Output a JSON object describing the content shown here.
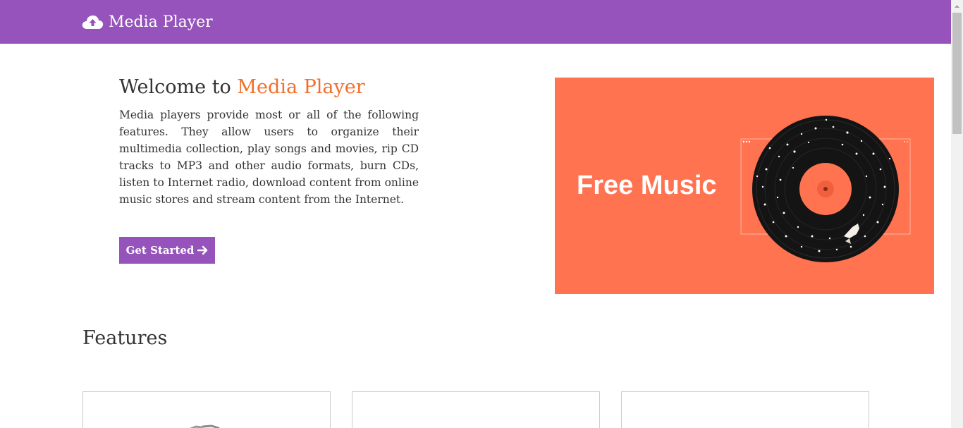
{
  "navbar": {
    "brand_name": "Media Player",
    "brand_icon": "cloud-upload-icon",
    "background": "#9553bb"
  },
  "hero": {
    "title_prefix": "Welcome to",
    "title_accent": "Media Player",
    "accent_color": "#f26f2b",
    "description": "Media players provide most or all of the following features. They allow users to organize their multimedia collection, play songs and movies, rip CD tracks to MP3 and other audio formats, burn CDs, listen to Internet radio, download content from online music stores and stream content from the Internet.",
    "cta_label": "Get Started",
    "cta_icon": "arrow-right-icon"
  },
  "banner": {
    "text": "Free Music",
    "background": "#ff7350",
    "image": "vinyl-record-illustration"
  },
  "features": {
    "heading": "Features",
    "cards": [
      {
        "icon": "feature-icon"
      },
      {
        "icon": ""
      },
      {
        "icon": ""
      }
    ]
  }
}
